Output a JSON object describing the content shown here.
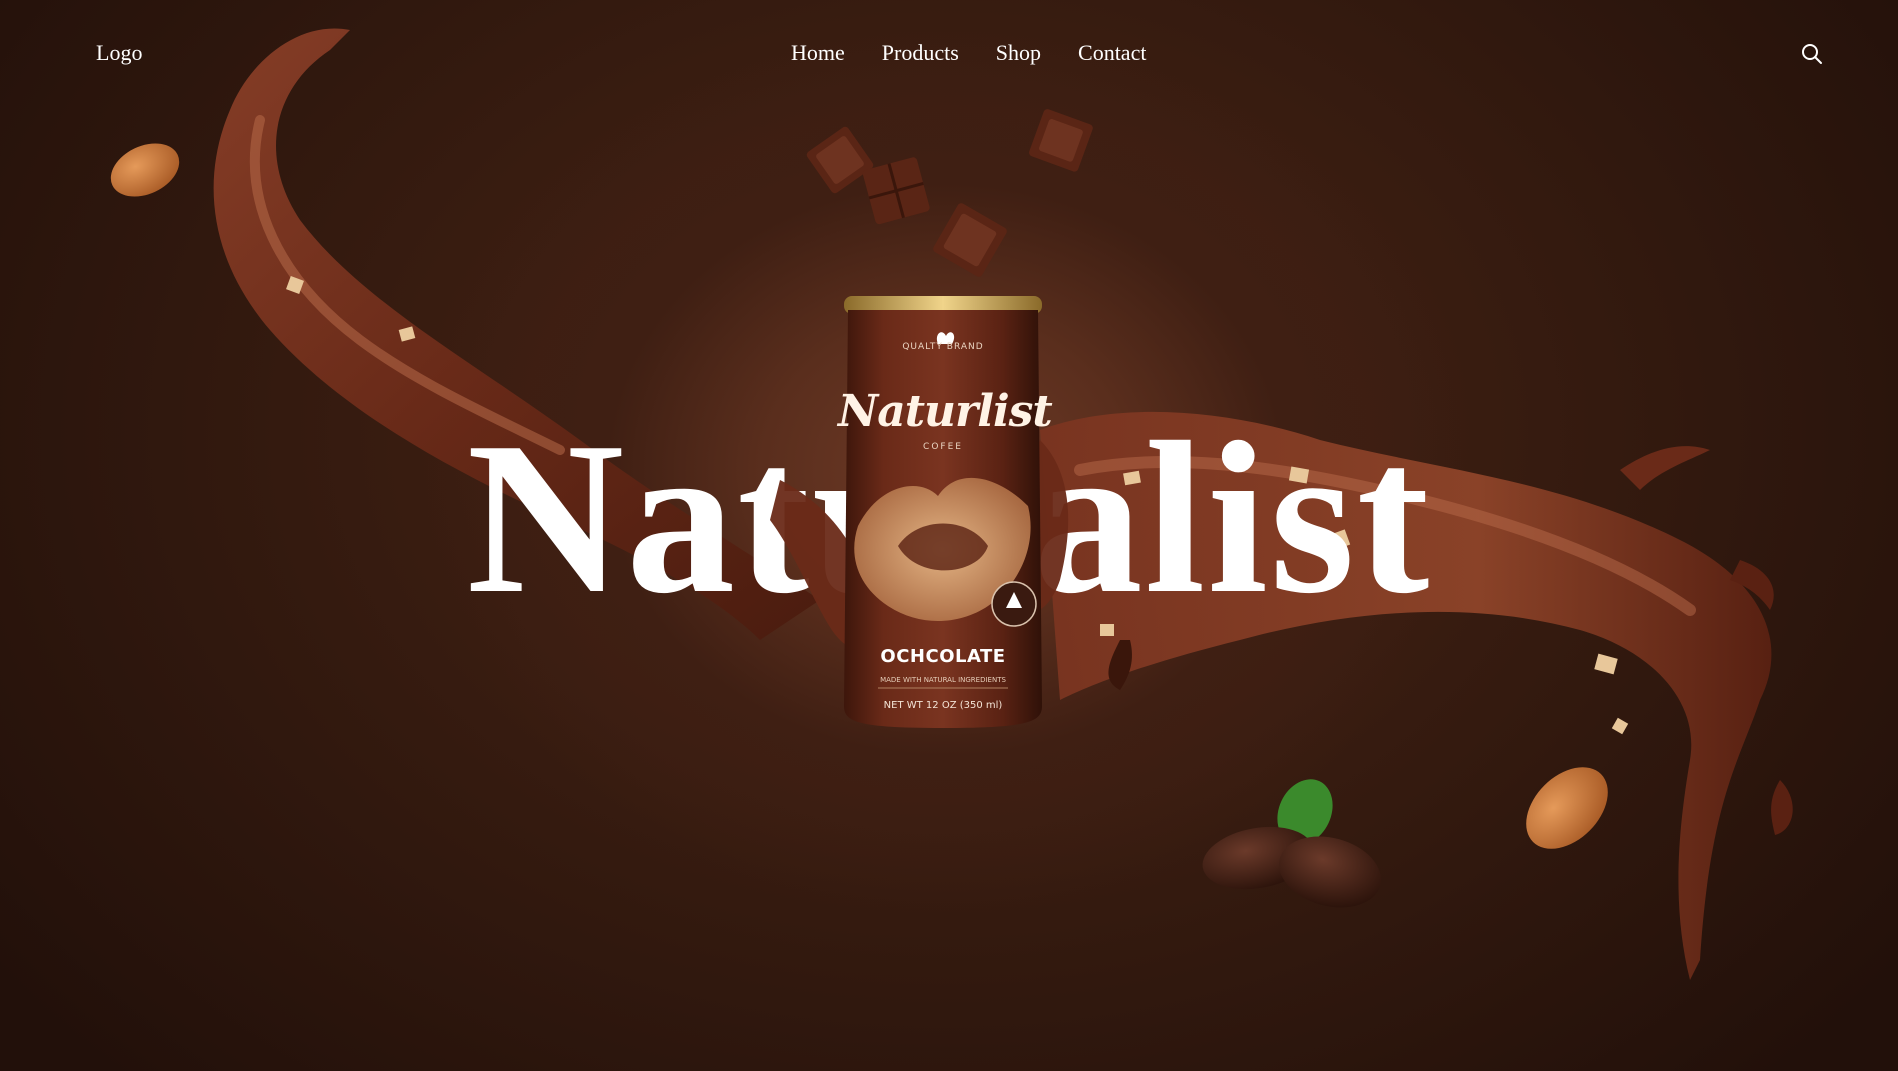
{
  "nav": {
    "logo": "Logo",
    "links": [
      "Home",
      "Products",
      "Shop",
      "Contact"
    ],
    "search_icon": "search-icon"
  },
  "hero": {
    "title": "Naturalist"
  },
  "product": {
    "brand": "Naturlist",
    "top_line": "QUALTY BRAND",
    "sub_line": "COFEE",
    "flavor": "OCHCOLATE",
    "fine_print": "MADE WITH NATURAL INGREDIENTS",
    "net": "NET WT 12 OZ (350 ml)"
  },
  "colors": {
    "background": "#2a130b",
    "chocolate": "#6b2f1d",
    "text": "#ffffff"
  }
}
